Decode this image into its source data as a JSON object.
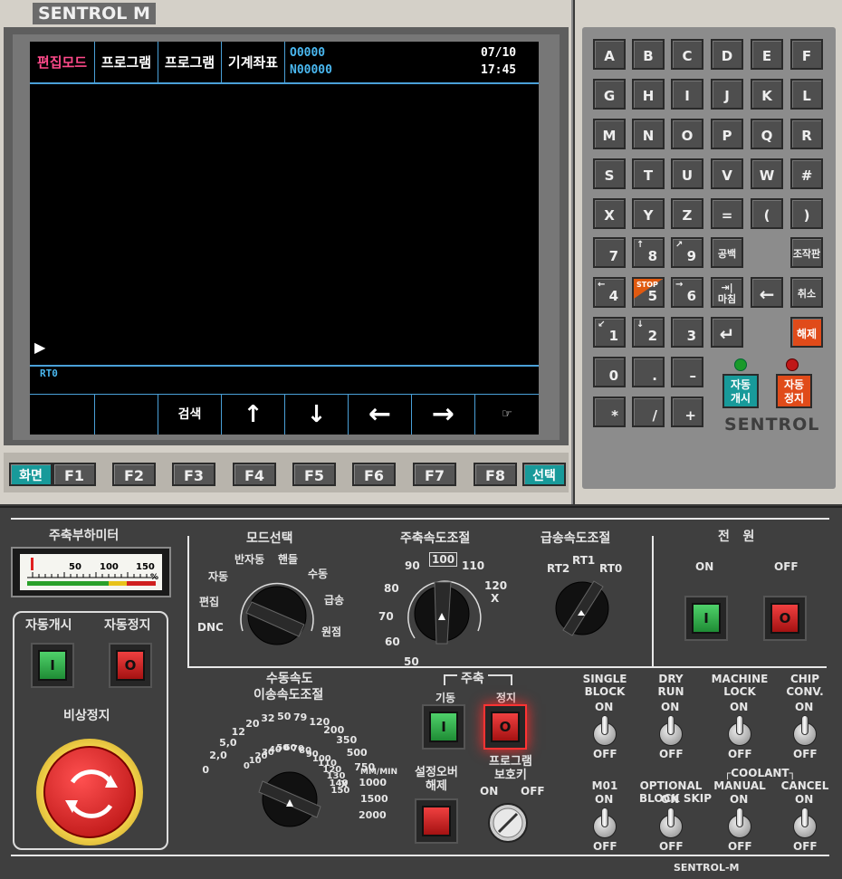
{
  "brand_tag": "SENTROL M",
  "screen": {
    "header": {
      "mode": "편집모드",
      "tab1": "프로그램",
      "tab2": "프로그램",
      "tab3": "기계좌표",
      "prog_o": "O0000",
      "prog_n": "N00000",
      "date": "07/10",
      "time": "17:45"
    },
    "cursor": "▶",
    "status": "RT0",
    "softkeys": [
      "",
      "",
      "검색",
      "↑",
      "↓",
      "←",
      "→",
      "☞"
    ]
  },
  "fkeys": {
    "left": "화면",
    "right": "선택",
    "keys": [
      "F1",
      "F2",
      "F3",
      "F4",
      "F5",
      "F6",
      "F7",
      "F8"
    ]
  },
  "keypad": {
    "rows": [
      [
        "A",
        "B",
        "C",
        "D",
        "E",
        "F"
      ],
      [
        "G",
        "H",
        "I",
        "J",
        "K",
        "L"
      ],
      [
        "M",
        "N",
        "O",
        "P",
        "Q",
        "R"
      ],
      [
        "S",
        "T",
        "U",
        "V",
        "W",
        "#"
      ],
      [
        "X",
        "Y",
        "Z",
        "=",
        "(",
        ")"
      ]
    ],
    "num": {
      "k7": "7",
      "k8": "8",
      "k8s": "↑",
      "k9": "9",
      "k9s": "↗",
      "k4": "4",
      "k4s": "←",
      "k5": "5",
      "k5s": "STOP",
      "k6": "6",
      "k6s": "→",
      "k1": "1",
      "k1s": "↙",
      "k2": "2",
      "k2s": "↓",
      "k3": "3",
      "k0": "0",
      "kdot": ".",
      "kminus": "–",
      "kstar": "*",
      "kslash": "/",
      "kplus": "+"
    },
    "space": "공백",
    "panel": "조작판",
    "tab_main": "⇥|",
    "tab_sub": "마침",
    "backspace": "←",
    "cancel": "취소",
    "enter": "↵",
    "release": "해제",
    "auto_start": "자동\n개시",
    "auto_stop": "자동\n정지",
    "logo": "SENTROL",
    "lamp_colors": {
      "start": "#1a9a2a",
      "stop": "#c01818"
    }
  },
  "lower": {
    "spindle_load": {
      "title": "주축부하미터",
      "ticks": [
        "50",
        "100",
        "150"
      ],
      "unit": "%"
    },
    "auto_start": "자동개시",
    "auto_stop": "자동정지",
    "btn_on": "I",
    "btn_off": "O",
    "estop": "비상정지",
    "mode_select": {
      "title": "모드선택",
      "positions": [
        "DNC",
        "편집",
        "자동",
        "반자동",
        "핸들",
        "수동",
        "급송",
        "원점"
      ]
    },
    "spindle_speed": {
      "title": "주축속도조절",
      "ticks": [
        "50",
        "60",
        "70",
        "80",
        "90",
        "100",
        "110",
        "120"
      ],
      "unit": "X"
    },
    "rapid_speed": {
      "title": "급송속도조절",
      "ticks": [
        "RT2",
        "RT1",
        "RT0"
      ]
    },
    "power": {
      "title": "전   원",
      "on": "ON",
      "off": "OFF"
    },
    "jog_speed": {
      "title1": "수동속도",
      "title2": "이송속도조절",
      "outer_ticks": [
        "0",
        "2,0",
        "5,0",
        "12",
        "20",
        "32",
        "50",
        "79",
        "120",
        "200",
        "350",
        "500",
        "750",
        "1000",
        "1500",
        "2000"
      ],
      "outer_unit": "MM/MIN",
      "inner_ticks": [
        "0",
        "10",
        "20",
        "30",
        "40",
        "50",
        "60",
        "70",
        "80",
        "90",
        "100",
        "110",
        "120",
        "130",
        "140",
        "150"
      ],
      "inner_unit": "X"
    },
    "spindle": {
      "title": "주축",
      "start": "기동",
      "stop": "정지"
    },
    "override_release": "설정오버\n해제",
    "program_key": {
      "title": "프로그램\n보호키",
      "on": "ON",
      "off": "OFF"
    },
    "toggles_row1": [
      {
        "label": "SINGLE\nBLOCK",
        "on": "ON",
        "off": "OFF"
      },
      {
        "label": "DRY\nRUN",
        "on": "ON",
        "off": "OFF"
      },
      {
        "label": "MACHINE\nLOCK",
        "on": "ON",
        "off": "OFF"
      },
      {
        "label": "CHIP\nCONV.",
        "on": "ON",
        "off": "OFF"
      }
    ],
    "toggles_row2": [
      {
        "label": "M01",
        "on": "ON",
        "off": "OFF"
      },
      {
        "label": "OPTIONAL\nBLOCK SKIP",
        "on": "ON",
        "off": "OFF"
      },
      {
        "label": "MANUAL",
        "on": "ON",
        "off": "OFF"
      },
      {
        "label": "CANCEL",
        "on": "ON",
        "off": "OFF"
      }
    ],
    "coolant": "COOLANT",
    "footer": "SENTROL-M"
  }
}
